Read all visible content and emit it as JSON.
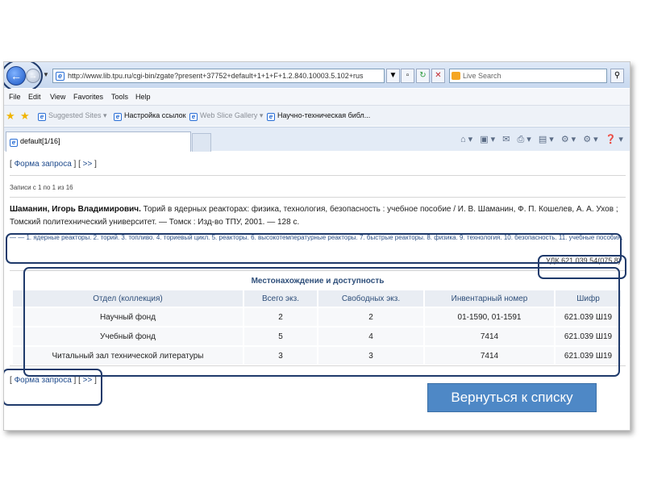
{
  "browser": {
    "url": "http://www.lib.tpu.ru/cgi-bin/zgate?present+37752+default+1+1+F+1.2.840.10003.5.102+rus",
    "search_placeholder": "Live Search",
    "menu": [
      "File",
      "Edit",
      "View",
      "Favorites",
      "Tools",
      "Help"
    ],
    "favorites": [
      {
        "label": "Suggested Sites ▾",
        "dim": true
      },
      {
        "label": "Настройка ссылок",
        "dim": false
      },
      {
        "label": "Web Slice Gallery ▾",
        "dim": true
      },
      {
        "label": "Научно-техническая библ...",
        "dim": false
      }
    ],
    "tab_title": "default[1/16]"
  },
  "page": {
    "top_links": {
      "request_form": "Форма запроса",
      "next": ">>"
    },
    "records_info": "Записи с 1 по 1 из 16",
    "author": "Шаманин, Игорь Владимирович.",
    "biblio_text": "Торий в ядерных реакторах: физика, технология, безопасность : учебное пособие / И. В. Шаманин, Ф. П. Кошелев, А. А. Ухов ; Томский политехнический университет. — Томск : Изд-во ТПУ, 2001. — 128 с.",
    "subjects": "— — 1. ядерные реакторы. 2. торий. 3. топливо. 4. ториевый цикл. 5. реакторы. 6. высокотемпературные реакторы. 7. быстрые реакторы. 8. физика. 9. технология. 10. безопасность. 11. учебные пособия.",
    "udk": "УДК 621.039.54(075.8)",
    "table": {
      "title": "Местонахождение и доступность",
      "headers": [
        "Отдел (коллекция)",
        "Всего экз.",
        "Свободных экз.",
        "Инвентарный номер",
        "Шифр"
      ],
      "rows": [
        [
          "Научный фонд",
          "2",
          "2",
          "01-1590, 01-1591",
          "621.039 Ш19"
        ],
        [
          "Учебный фонд",
          "5",
          "4",
          "7414",
          "621.039 Ш19"
        ],
        [
          "Читальный зал технической литературы",
          "3",
          "3",
          "7414",
          "621.039 Ш19"
        ]
      ]
    },
    "bottom_links": {
      "request_form": "Форма запроса",
      "next": ">>"
    }
  },
  "back_button": "Вернуться к списку",
  "colors": {
    "annotation": "#1f3a6b",
    "button": "#4e88c6",
    "link": "#1e4a8c"
  }
}
